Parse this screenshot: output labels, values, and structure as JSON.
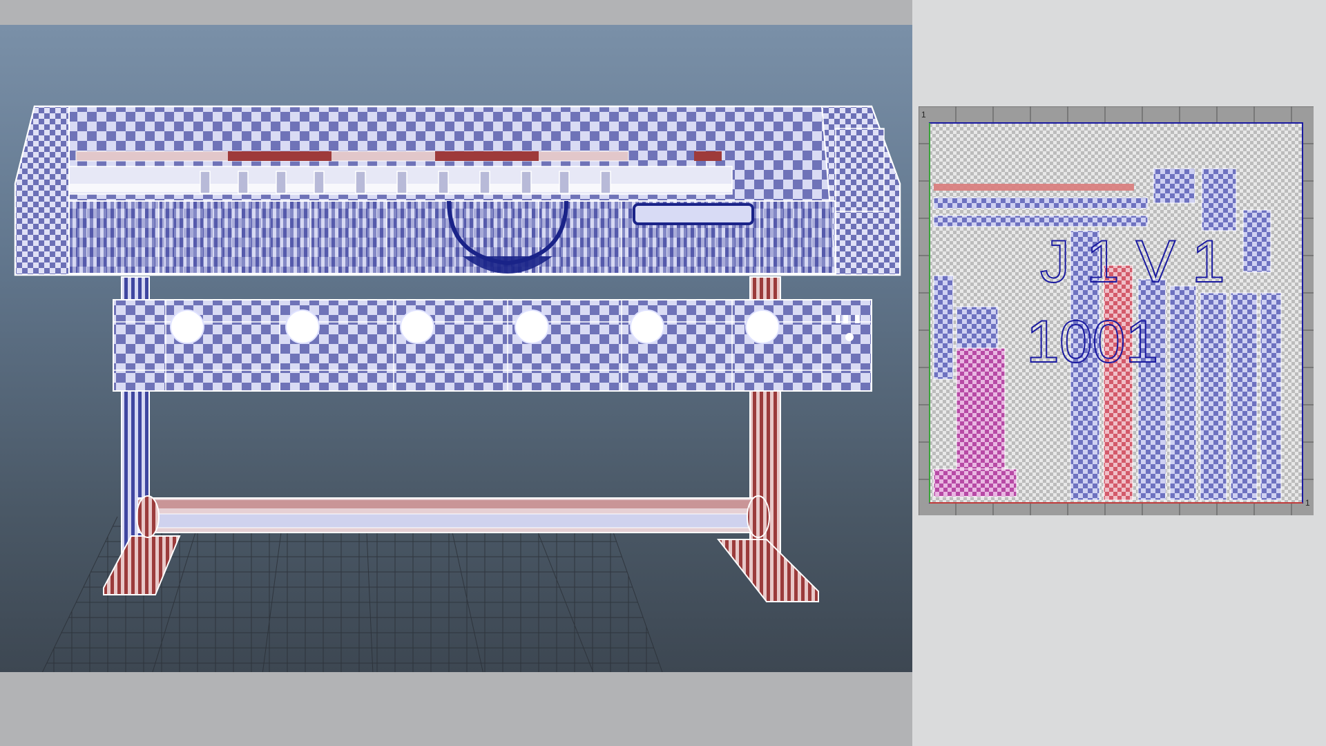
{
  "viewport": {
    "name": "3d-perspective-viewport",
    "background_top": "#7a90a8",
    "background_bottom": "#3d4752",
    "model": "large-format-printer",
    "checker_color": "#7a7ec0",
    "highlight_color": "#b06464"
  },
  "uv_editor": {
    "corner_label": "1",
    "tile_label": "1001",
    "side_label": "1",
    "checker_color": "#6e72c0",
    "magenta_color": "#c850b4",
    "red_color": "#d85a5a"
  }
}
